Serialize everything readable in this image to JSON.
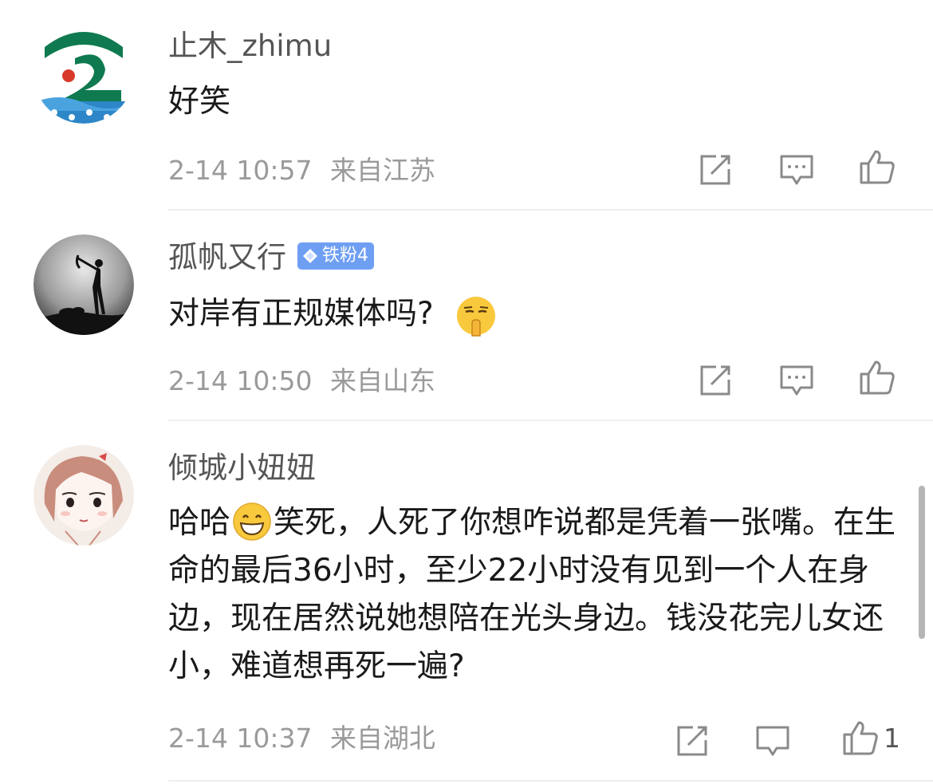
{
  "comments": [
    {
      "username": "止木_zhimu",
      "text": "好笑",
      "time": "2-14 10:57",
      "location": "来自江苏",
      "avatar": "logo-avatar"
    },
    {
      "username": "孤帆又行",
      "badge": "铁粉4",
      "text": "对岸有正规媒体吗?",
      "emoji": "shushing-face-emoji",
      "time": "2-14 10:50",
      "location": "来自山东",
      "avatar": "silhouette-archer-avatar"
    },
    {
      "username": "倾城小妞妞",
      "text_prefix": "哈哈",
      "emoji": "grinning-face-emoji",
      "text": "笑死，人死了你想咋说都是凭着一张嘴。在生命的最后36小时，至少22小时没有见到一个人在身边，现在居然说她想陪在光头身边。钱没花完儿女还小，难道想再死一遍?",
      "time": "2-14 10:37",
      "location": "来自湖北",
      "like_count": "1",
      "avatar": "cartoon-girl-avatar"
    }
  ],
  "icons": {
    "share": "share-icon",
    "comment": "comment-icon",
    "like": "thumbs-up-icon",
    "badge": "diamond-icon"
  },
  "colors": {
    "username": "#555555",
    "meta": "#9a9a9a",
    "badge": "#6f9ff3",
    "logo_green": "#0f7a4f",
    "logo_blue": "#2c86c7"
  }
}
